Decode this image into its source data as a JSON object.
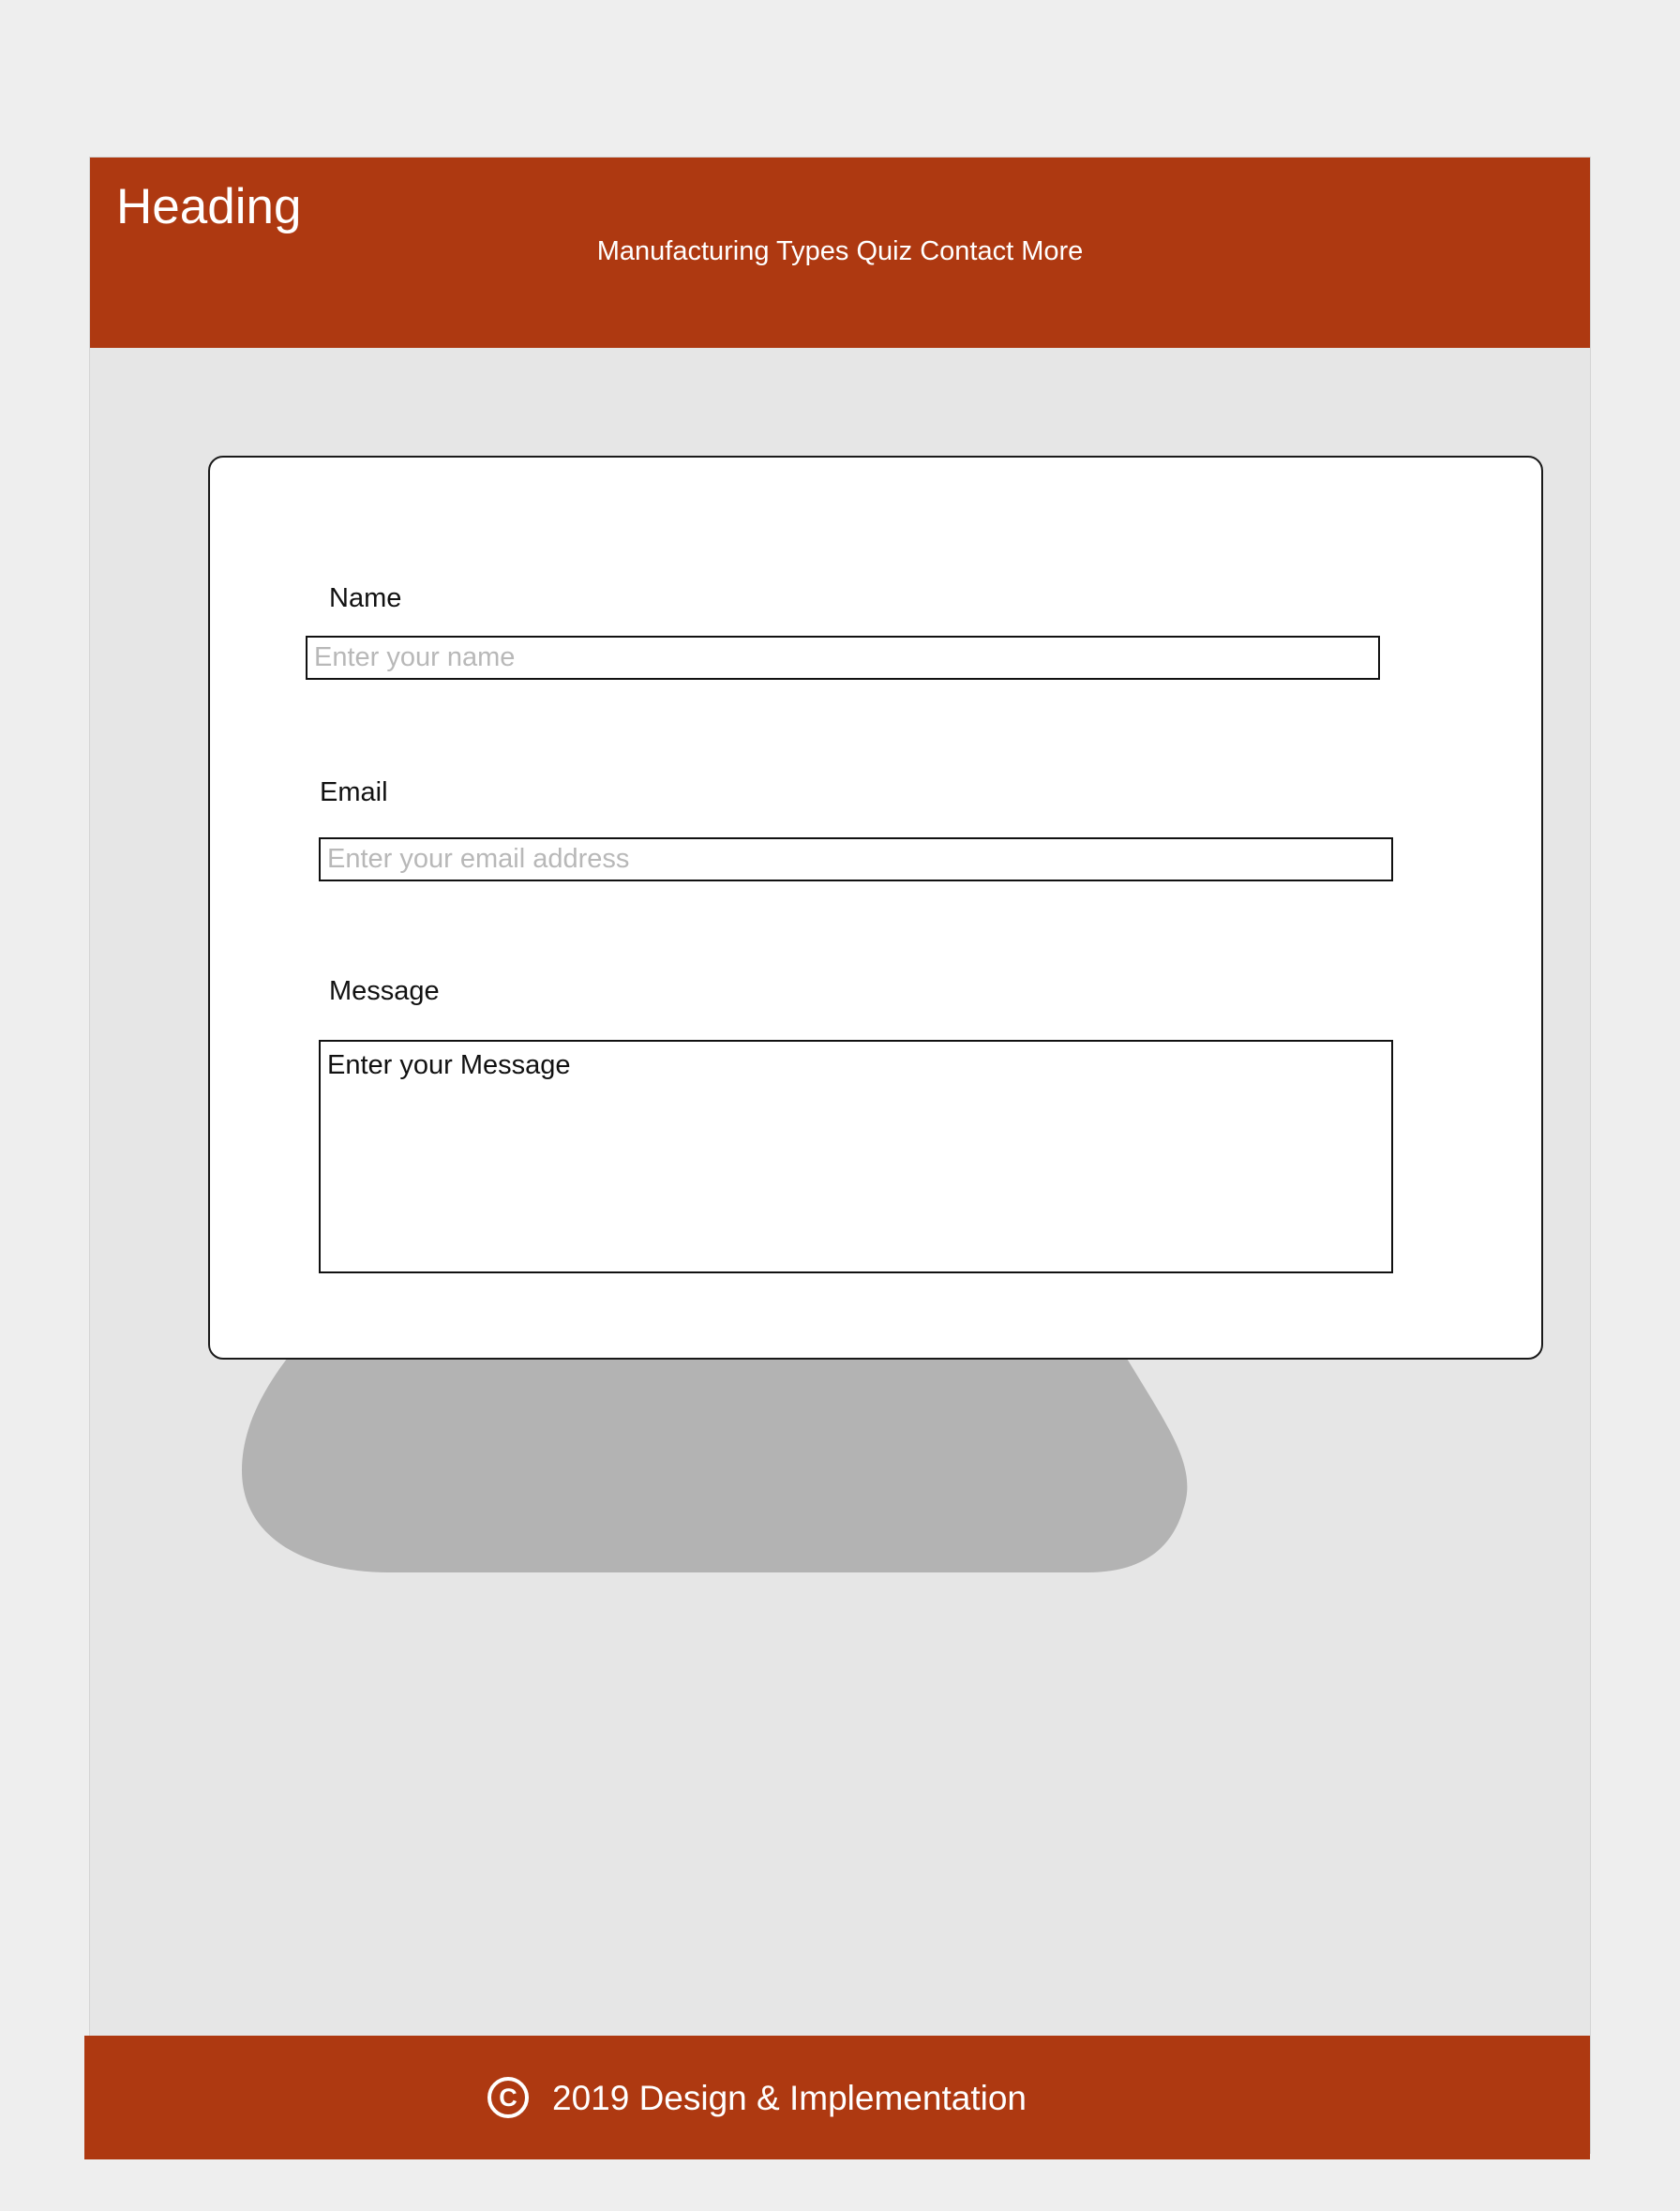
{
  "header": {
    "brand": "Heading",
    "nav": [
      "Manufacturing",
      "Types",
      "Quiz",
      "Contact",
      "More"
    ]
  },
  "form": {
    "name": {
      "label": "Name",
      "placeholder": "Enter your name"
    },
    "email": {
      "label": "Email",
      "placeholder": "Enter your email address"
    },
    "message": {
      "label": "Message",
      "value": "Enter your Message"
    }
  },
  "footer": {
    "icon": "copyright-icon",
    "icon_glyph": "C",
    "text": "2019 Design & Implementation"
  },
  "colors": {
    "brand": "#ae3911",
    "page_background": "#e6e6e6",
    "blob": "#b3b3b3"
  }
}
